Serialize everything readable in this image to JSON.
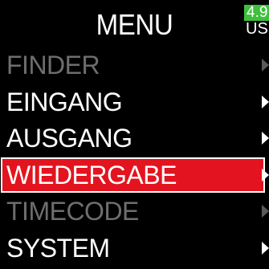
{
  "header": {
    "title": "MENU"
  },
  "battery": {
    "level": "4.9",
    "label": "USB",
    "color": "#3ec03c"
  },
  "menu": {
    "items": [
      {
        "label": "FINDER",
        "state": "disabled"
      },
      {
        "label": "EINGANG",
        "state": "enabled"
      },
      {
        "label": "AUSGANG",
        "state": "enabled"
      },
      {
        "label": "WIEDERGABE",
        "state": "selected"
      },
      {
        "label": "TIMECODE",
        "state": "disabled"
      },
      {
        "label": "SYSTEM",
        "state": "enabled"
      }
    ],
    "selected_color": "#e3141f",
    "arrow_icon": "chevron-right-icon"
  }
}
